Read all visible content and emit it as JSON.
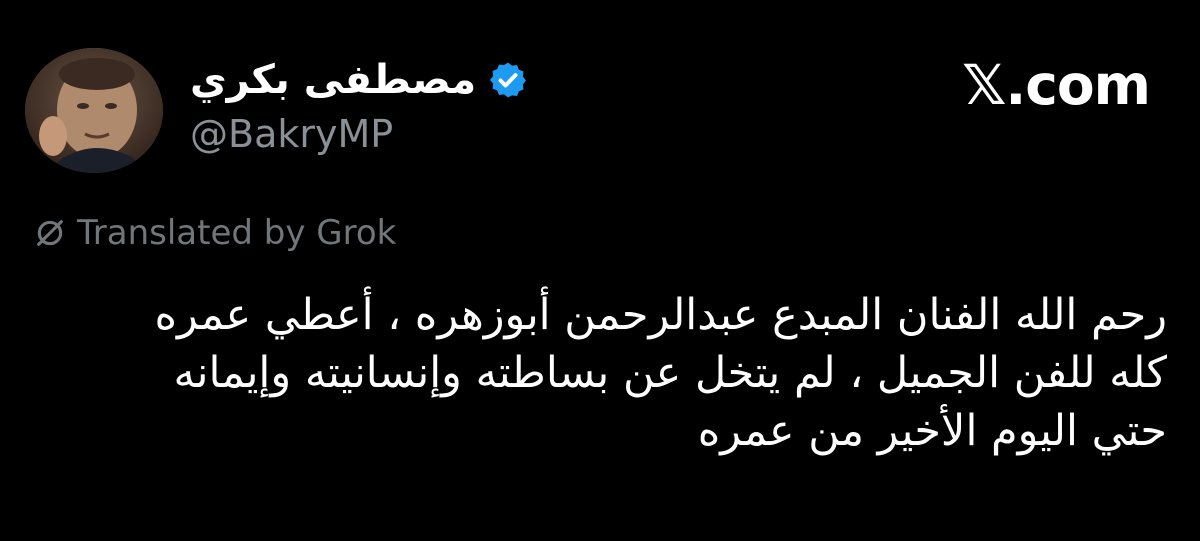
{
  "author": {
    "display_name": "مصطفى بكري",
    "handle": "@BakryMP",
    "verified_icon": "verified-badge-icon",
    "verified_color": "#1d9bf0",
    "avatar": "profile-photo"
  },
  "site": {
    "logo_text": "𝕏.com"
  },
  "translation": {
    "icon": "grok-icon",
    "label": "Translated by Grok"
  },
  "tweet": {
    "lines": [
      "رحم الله الفنان المبدع عبدالرحمن أبوزهره ، أعطي عمره",
      "كله للفن الجميل ، لم يتخل عن بساطته وإنسانيته وإيمانه",
      "حتي اليوم الأخير من عمره"
    ]
  },
  "colors": {
    "background": "#000000",
    "text_primary": "#ffffff",
    "text_secondary": "#8b9097",
    "accent": "#1d9bf0"
  }
}
